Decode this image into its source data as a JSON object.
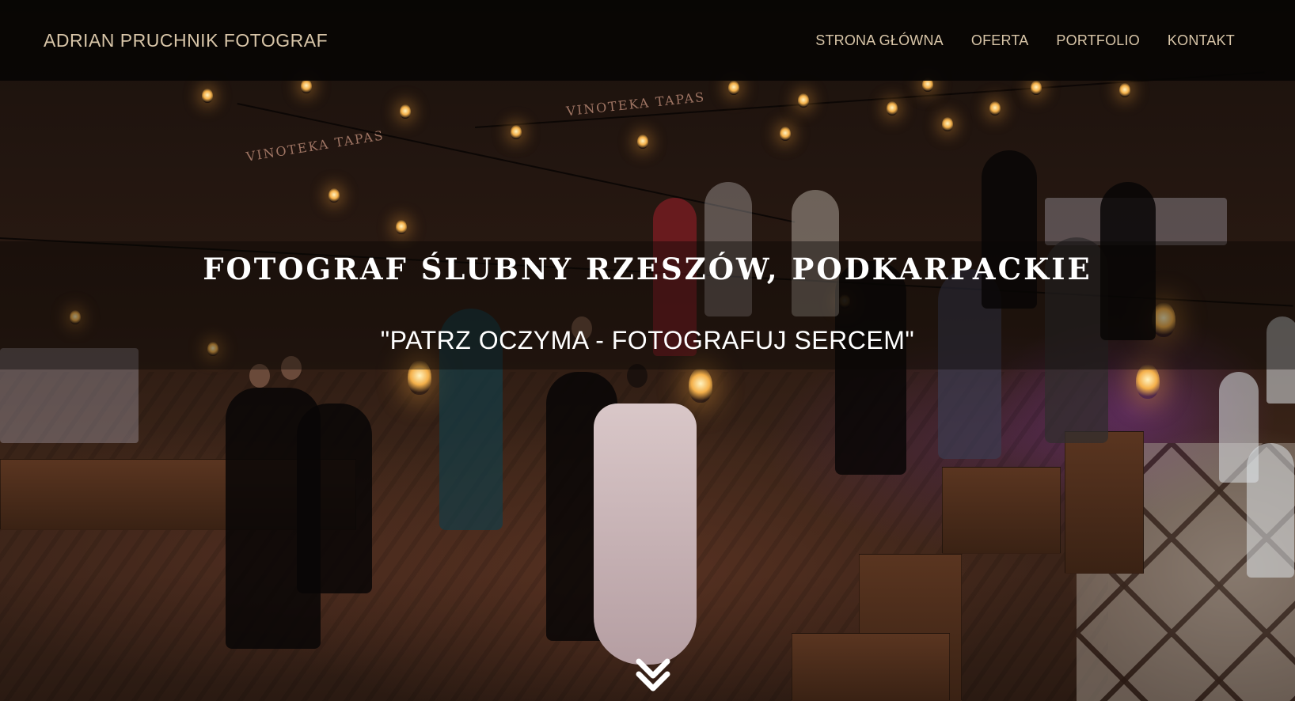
{
  "header": {
    "brand": "ADRIAN PRUCHNIK FOTOGRAF",
    "nav": [
      {
        "label": "STRONA GŁÓWNA"
      },
      {
        "label": "OFERTA"
      },
      {
        "label": "PORTFOLIO"
      },
      {
        "label": "KONTAKT"
      }
    ]
  },
  "hero": {
    "title": "FOTOGRAF ŚLUBNY RZESZÓW, PODKARPACKIE",
    "subtitle": "\"PATRZ OCZYMA - FOTOGRAFUJ SERCEM\"",
    "background_image": {
      "signs": [
        "VINOTEKA TAPAS",
        "VINOTEKA TAPAS"
      ]
    },
    "scroll_icon": "double-chevron-down-icon"
  },
  "colors": {
    "nav_text": "#d8c5a8",
    "navbar_bg": "#080504",
    "hero_text": "#ffffff"
  }
}
